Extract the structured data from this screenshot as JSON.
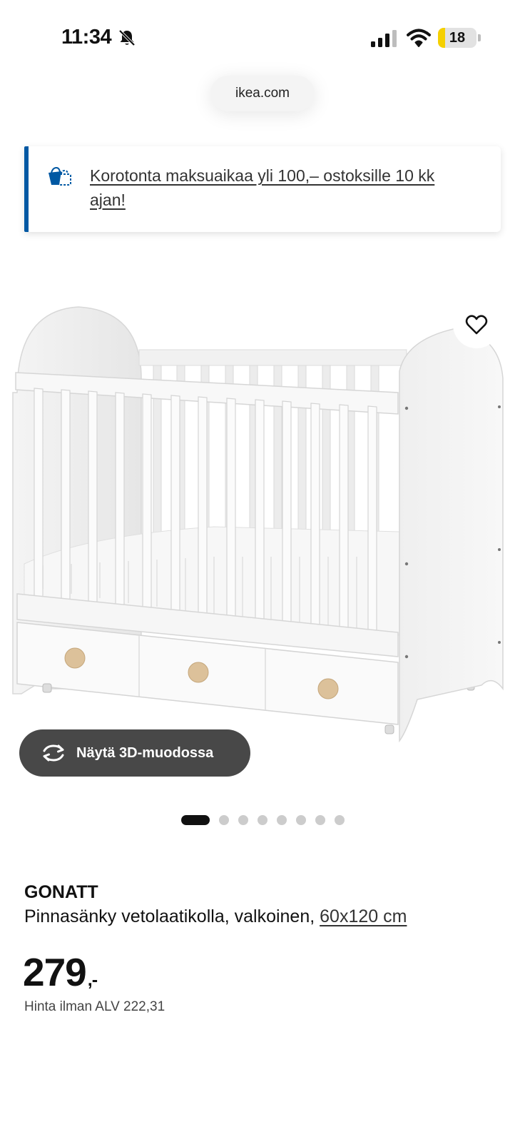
{
  "status_bar": {
    "time": "11:34",
    "battery": "18",
    "battery_level": 0.18,
    "icons": [
      "bell-slash-icon",
      "signal-icon",
      "wifi-icon",
      "battery-icon"
    ]
  },
  "browser": {
    "url": "ikea.com"
  },
  "promo": {
    "icon": "shopping-bag-icon",
    "text": "Korotonta maksuaikaa yli 100,– ostoksille 10 kk ajan!",
    "accent_color": "#0058a3"
  },
  "product_image": {
    "alt": "crib-image",
    "favorite_icon": "heart-icon"
  },
  "view_3d": {
    "label": "Näytä 3D-muodossa",
    "icon": "rotate-icon"
  },
  "carousel": {
    "total": 8,
    "active_index": 0
  },
  "product": {
    "brand": "GONATT",
    "description": "Pinnasänky vetolaatikolla, valkoinen, ",
    "size": "60x120 cm",
    "price": "279",
    "price_suffix": ",-",
    "price_excl_vat": "Hinta ilman ALV 222,31"
  }
}
